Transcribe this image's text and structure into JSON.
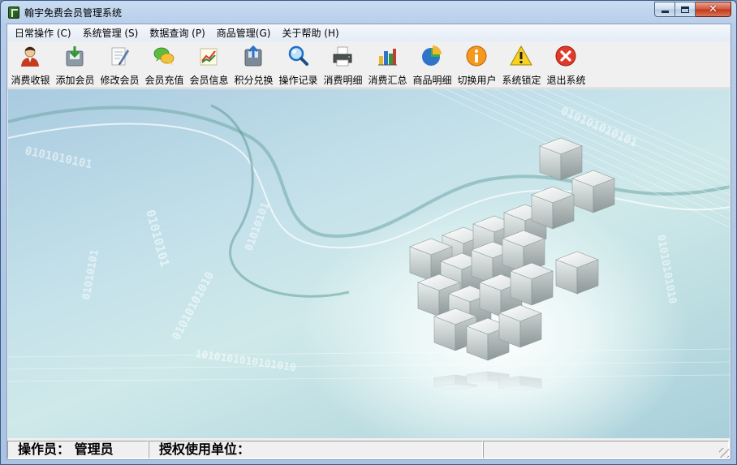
{
  "window": {
    "title": "翰宇免费会员管理系统"
  },
  "menubar": {
    "items": [
      {
        "label": "日常操作 (C)"
      },
      {
        "label": "系统管理 (S)"
      },
      {
        "label": "数据查询 (P)"
      },
      {
        "label": "商品管理(G)"
      },
      {
        "label": "关于帮助 (H)"
      }
    ]
  },
  "toolbar": {
    "items": [
      {
        "label": "消费收银",
        "icon": "cashier-person-icon"
      },
      {
        "label": "添加会员",
        "icon": "add-member-icon"
      },
      {
        "label": "修改会员",
        "icon": "edit-member-icon"
      },
      {
        "label": "会员充值",
        "icon": "recharge-chat-icon"
      },
      {
        "label": "会员信息",
        "icon": "member-info-chart-icon"
      },
      {
        "label": "积分兑换",
        "icon": "points-exchange-icon"
      },
      {
        "label": "操作记录",
        "icon": "search-magnifier-icon"
      },
      {
        "label": "消费明细",
        "icon": "printer-icon"
      },
      {
        "label": "消费汇总",
        "icon": "bar-chart-icon"
      },
      {
        "label": "商品明细",
        "icon": "pie-chart-icon"
      },
      {
        "label": "切换用户",
        "icon": "info-icon"
      },
      {
        "label": "系统锁定",
        "icon": "warning-icon"
      },
      {
        "label": "退出系统",
        "icon": "exit-close-icon"
      }
    ]
  },
  "statusbar": {
    "operator": "操作员：  管理员",
    "licensee": "授权使用单位："
  },
  "canvas": {
    "binary_text": "0101010101"
  },
  "colors": {
    "accent": "#3c5a82",
    "close_button": "#c23718",
    "background_teal": "#c4e1ea"
  }
}
